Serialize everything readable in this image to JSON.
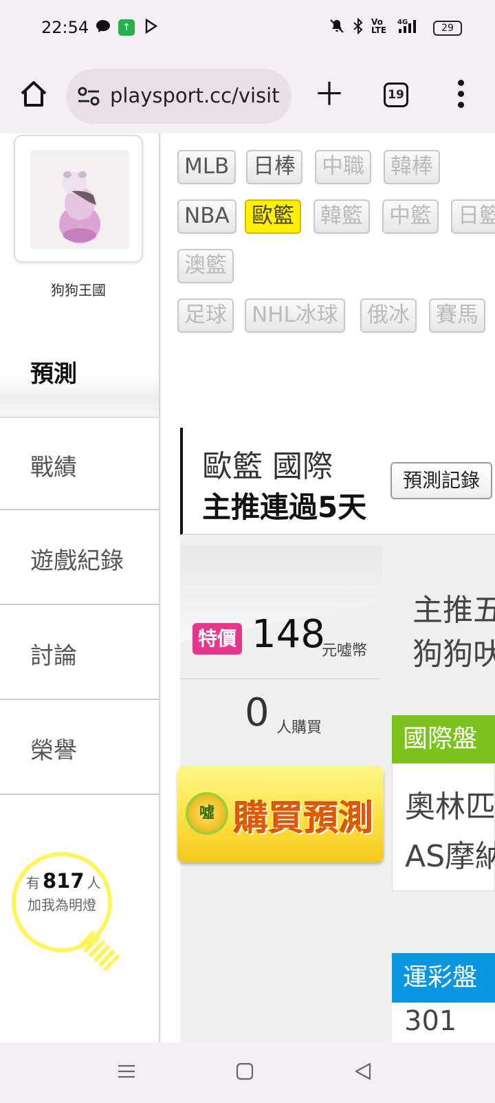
{
  "status_bar": {
    "time": "22:54",
    "battery": "29",
    "icons": [
      "chat-bubble-icon",
      "app-update-icon",
      "play-store-icon",
      "mute-icon",
      "bluetooth-icon",
      "volte-icon",
      "signal-4g-icon",
      "battery-icon"
    ]
  },
  "browser": {
    "url": "playsport.cc/visit",
    "tab_count": "19"
  },
  "profile": {
    "username": "狗狗王國"
  },
  "left_nav": {
    "items": [
      {
        "label": "預測"
      },
      {
        "label": "戰績"
      },
      {
        "label": "遊戲紀錄"
      },
      {
        "label": "討論"
      },
      {
        "label": "榮譽"
      }
    ]
  },
  "fans": {
    "prefix": "有",
    "count": "817",
    "suffix": "人",
    "line2": "加我為明燈"
  },
  "sport_filters": {
    "row1": [
      "MLB",
      "日棒",
      "中職",
      "韓棒"
    ],
    "row2": [
      "NBA",
      "歐籃",
      "韓籃",
      "中籃",
      "日籃"
    ],
    "row3": [
      "澳籃"
    ],
    "row4": [
      "足球",
      "NHL冰球",
      "俄冰",
      "賽馬"
    ],
    "selected": "歐籃"
  },
  "prediction": {
    "league": "歐籃 國際",
    "streak": "主推連過5天",
    "record_button": "預測記錄",
    "special_label": "特價",
    "price": "148",
    "price_unit": "元噓幣",
    "buyers": "0",
    "buyers_unit": "人購買",
    "buy_button": "購買預測",
    "buy_coin": "噓",
    "desc_line1": "主推五",
    "desc_line2": "狗狗吠",
    "intl_label": "國際盤",
    "match_line1": "奧林匹",
    "match_line2": "AS摩納",
    "sports_lottery_label": "運彩盤",
    "lottery_code": "301"
  },
  "colors": {
    "selected_chip": "#ffef00",
    "special_badge": "#e8368c",
    "intl_tag": "#7cc21c",
    "lottery_tag": "#0a96e0",
    "browser_chrome": "#f6eef7"
  }
}
